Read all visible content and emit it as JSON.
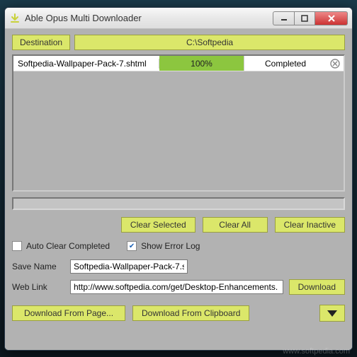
{
  "window": {
    "title": "Able Opus Multi Downloader"
  },
  "destination": {
    "label": "Destination",
    "path": "C:\\Softpedia"
  },
  "downloads": [
    {
      "name": "Softpedia-Wallpaper-Pack-7.shtml",
      "progress": "100%",
      "status": "Completed"
    }
  ],
  "buttons": {
    "clear_selected": "Clear Selected",
    "clear_all": "Clear All",
    "clear_inactive": "Clear Inactive",
    "download": "Download",
    "download_from_page": "Download From Page...",
    "download_from_clipboard": "Download From Clipboard"
  },
  "checks": {
    "auto_clear": {
      "label": "Auto Clear Completed",
      "checked": false
    },
    "show_error_log": {
      "label": "Show Error Log",
      "checked": true
    }
  },
  "form": {
    "save_name_label": "Save Name",
    "save_name_value": "Softpedia-Wallpaper-Pack-7.s",
    "web_link_label": "Web Link",
    "web_link_value": "http://www.softpedia.com/get/Desktop-Enhancements."
  },
  "watermark": "www.softpedia.com"
}
